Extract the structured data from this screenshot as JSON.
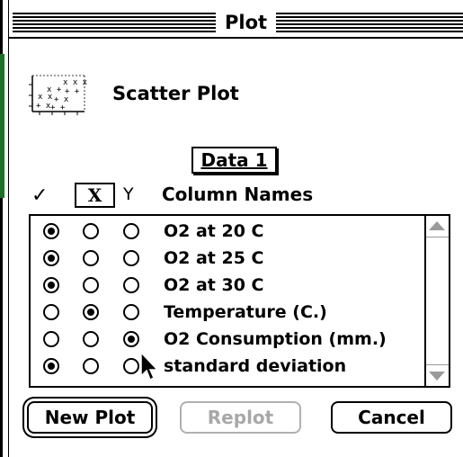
{
  "window": {
    "title": "Plot"
  },
  "plot_type": {
    "label": "Scatter Plot",
    "icon": "scatter-plot-icon"
  },
  "dataset_button": {
    "label": "Data 1"
  },
  "columns_header": {
    "check_symbol": "✓",
    "x_label": "X",
    "y_label": "Y",
    "names_label": "Column Names"
  },
  "columns": [
    {
      "name": "O2 at 20 C",
      "check": true,
      "x": false,
      "y": false
    },
    {
      "name": "O2 at 25 C",
      "check": true,
      "x": false,
      "y": false
    },
    {
      "name": "O2 at 30 C",
      "check": true,
      "x": false,
      "y": false
    },
    {
      "name": "Temperature (C.)",
      "check": false,
      "x": true,
      "y": false
    },
    {
      "name": "O2 Consumption (mm.)",
      "check": false,
      "x": false,
      "y": true
    },
    {
      "name": "standard deviation",
      "check": true,
      "x": false,
      "y": false
    }
  ],
  "buttons": {
    "new_plot": "New Plot",
    "replot": "Replot",
    "cancel": "Cancel"
  },
  "colors": {
    "disabled_text": "#a8a8a8",
    "border": "#000000"
  }
}
